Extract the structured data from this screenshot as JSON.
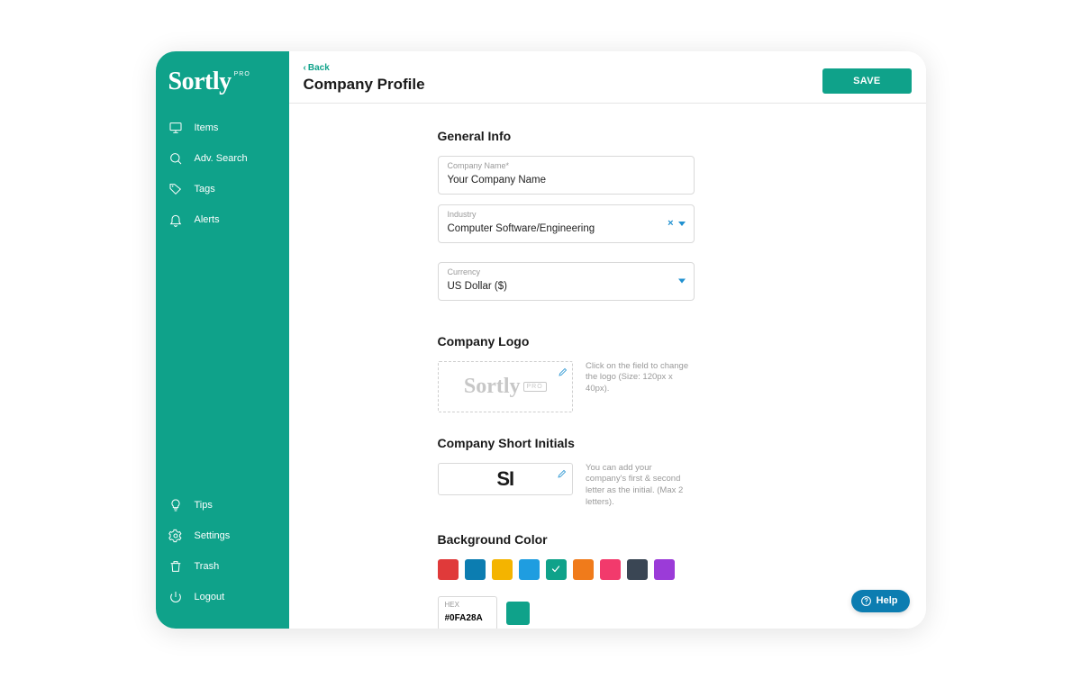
{
  "brand": {
    "name": "Sortly",
    "tag": "PRO"
  },
  "sidebar": {
    "top": [
      {
        "label": "Items"
      },
      {
        "label": "Adv. Search"
      },
      {
        "label": "Tags"
      },
      {
        "label": "Alerts"
      }
    ],
    "bottom": [
      {
        "label": "Tips"
      },
      {
        "label": "Settings"
      },
      {
        "label": "Trash"
      },
      {
        "label": "Logout"
      }
    ]
  },
  "header": {
    "back": "Back",
    "title": "Company Profile",
    "save": "SAVE"
  },
  "general": {
    "heading": "General Info",
    "company_name_label": "Company Name*",
    "company_name_value": "Your Company Name",
    "industry_label": "Industry",
    "industry_value": "Computer Software/Engineering",
    "currency_label": "Currency",
    "currency_value": "US Dollar ($)"
  },
  "logo": {
    "heading": "Company Logo",
    "placeholder_word": "Sortly",
    "placeholder_tag": "PRO",
    "hint": "Click on the field to change the logo (Size: 120px x 40px)."
  },
  "initials": {
    "heading": "Company Short Initials",
    "value": "SI",
    "hint": "You can add your company's first & second letter as the initial. (Max 2 letters)."
  },
  "bg": {
    "heading": "Background Color",
    "swatches": [
      "#e03a3a",
      "#0c7db1",
      "#f4b400",
      "#1f9de0",
      "#0fa28a",
      "#f07b1b",
      "#f23a6c",
      "#3a4654",
      "#9b3bd8"
    ],
    "selected_index": 4,
    "hex_label": "HEX",
    "hex_value": "#0FA28A"
  },
  "help": {
    "label": "Help"
  }
}
